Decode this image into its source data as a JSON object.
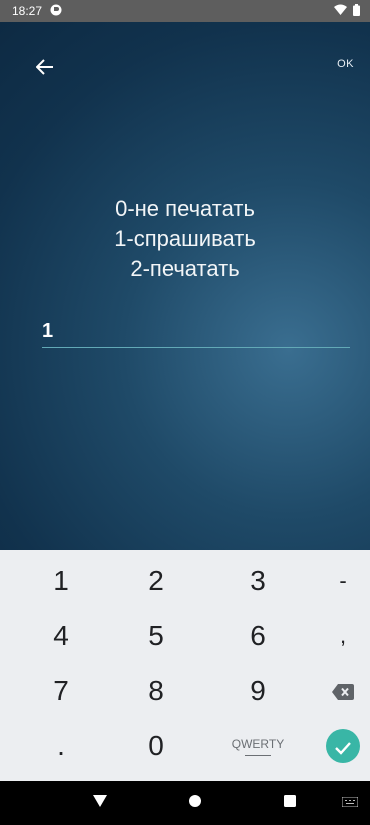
{
  "status": {
    "time": "18:27"
  },
  "header": {
    "ok_label": "OK"
  },
  "prompt": {
    "line1": "0-не печатать",
    "line2": "1-спрашивать",
    "line3": "2-печатать"
  },
  "input": {
    "value": "1"
  },
  "keypad": {
    "k1": "1",
    "k2": "2",
    "k3": "3",
    "dash": "-",
    "k4": "4",
    "k5": "5",
    "k6": "6",
    "comma": ",",
    "k7": "7",
    "k8": "8",
    "k9": "9",
    "dot": ".",
    "k0": "0",
    "qwerty": "QWERTY"
  },
  "colors": {
    "accent": "#39b6a6",
    "underline": "#62a9b6"
  },
  "icons": [
    "back-arrow-icon",
    "wifi-icon",
    "battery-icon",
    "backspace-icon",
    "check-icon",
    "nav-back-icon",
    "nav-home-icon",
    "nav-recents-icon",
    "keyboard-switch-icon"
  ]
}
